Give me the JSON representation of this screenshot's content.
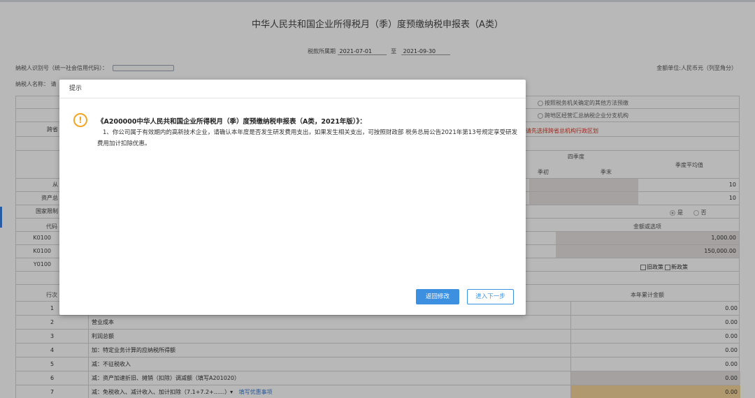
{
  "form": {
    "title": "中华人民共和国企业所得税月（季）度预缴纳税申报表（A类）",
    "period_label": "税款所属期",
    "period_start": "2021-07-01",
    "period_to": "至",
    "period_end": "2021-09-30",
    "taxpayer_id_label": "纳税人识别号（统一社会信用代码）：",
    "taxpayer_name_label": "纳税人名称：",
    "taxpayer_name_partial": "请",
    "unit_label": "金额单位:人民币元（列至角分）"
  },
  "upper": {
    "option1": "按照税务机关确定的其他方法预缴",
    "option2": "跨地区经营汇总纳税企业分支机构",
    "partial_label_cross": "跨省",
    "red_note": "请先选择跨省总机构行政区划",
    "q4_header": "四季度",
    "q_start": "季初",
    "q_end": "季末",
    "avg_header": "季度平均值",
    "partial_employees": "从",
    "partial_assets": "资产总",
    "partial_restricted": "国家限制",
    "employees_value": "10",
    "assets_value": "10",
    "yes_label": "是",
    "no_label": "否",
    "code_header": "代码",
    "amount_header": "金额或选项",
    "code1_partial": "K0100",
    "code1_value": "1,000.00",
    "code2_partial": "K0100",
    "code2_value": "150,000.00",
    "code3_partial": "Y0100",
    "old_policy": "旧政策",
    "new_policy": "新政策"
  },
  "lower": {
    "line_header": "行次",
    "accum_header": "本年累计金额",
    "rows": [
      {
        "no": "1",
        "label": "",
        "value": "0.00"
      },
      {
        "no": "2",
        "label": "营业成本",
        "value": "0.00"
      },
      {
        "no": "3",
        "label": "利润总额",
        "value": "0.00"
      },
      {
        "no": "4",
        "label": "加：特定业务计算的应纳税所得额",
        "value": "0.00"
      },
      {
        "no": "5",
        "label": "减：不征税收入",
        "value": "0.00"
      },
      {
        "no": "6",
        "label": "减：资产加速折旧、摊销（扣除）调减额（填写A201020）",
        "value": "0.00"
      },
      {
        "no": "7",
        "label": "减：免税收入、减计收入、加计扣除（7.1+7.2+......）▾",
        "link": "填写优惠事项",
        "value": "0.00"
      }
    ]
  },
  "dialog": {
    "title": "提示",
    "icon": "exclamation-icon",
    "heading": "《A200000中华人民共和国企业所得税月（季）度预缴纳税申报表（A类，2021年版）》：",
    "body": "1、你公司属于有效期内的高新技术企业，请确认本年度是否发生研发费用支出，如果发生相关支出，可按照财政部 税务总局公告2021年第13号规定享受研发费用加计扣除优惠。",
    "return_button": "返回修改",
    "next_button": "进入下一步"
  },
  "colors": {
    "primary": "#3d8fe0",
    "warning": "#f2a623",
    "error_text": "#d9392b",
    "highlight_cell": "#f6d49a"
  }
}
